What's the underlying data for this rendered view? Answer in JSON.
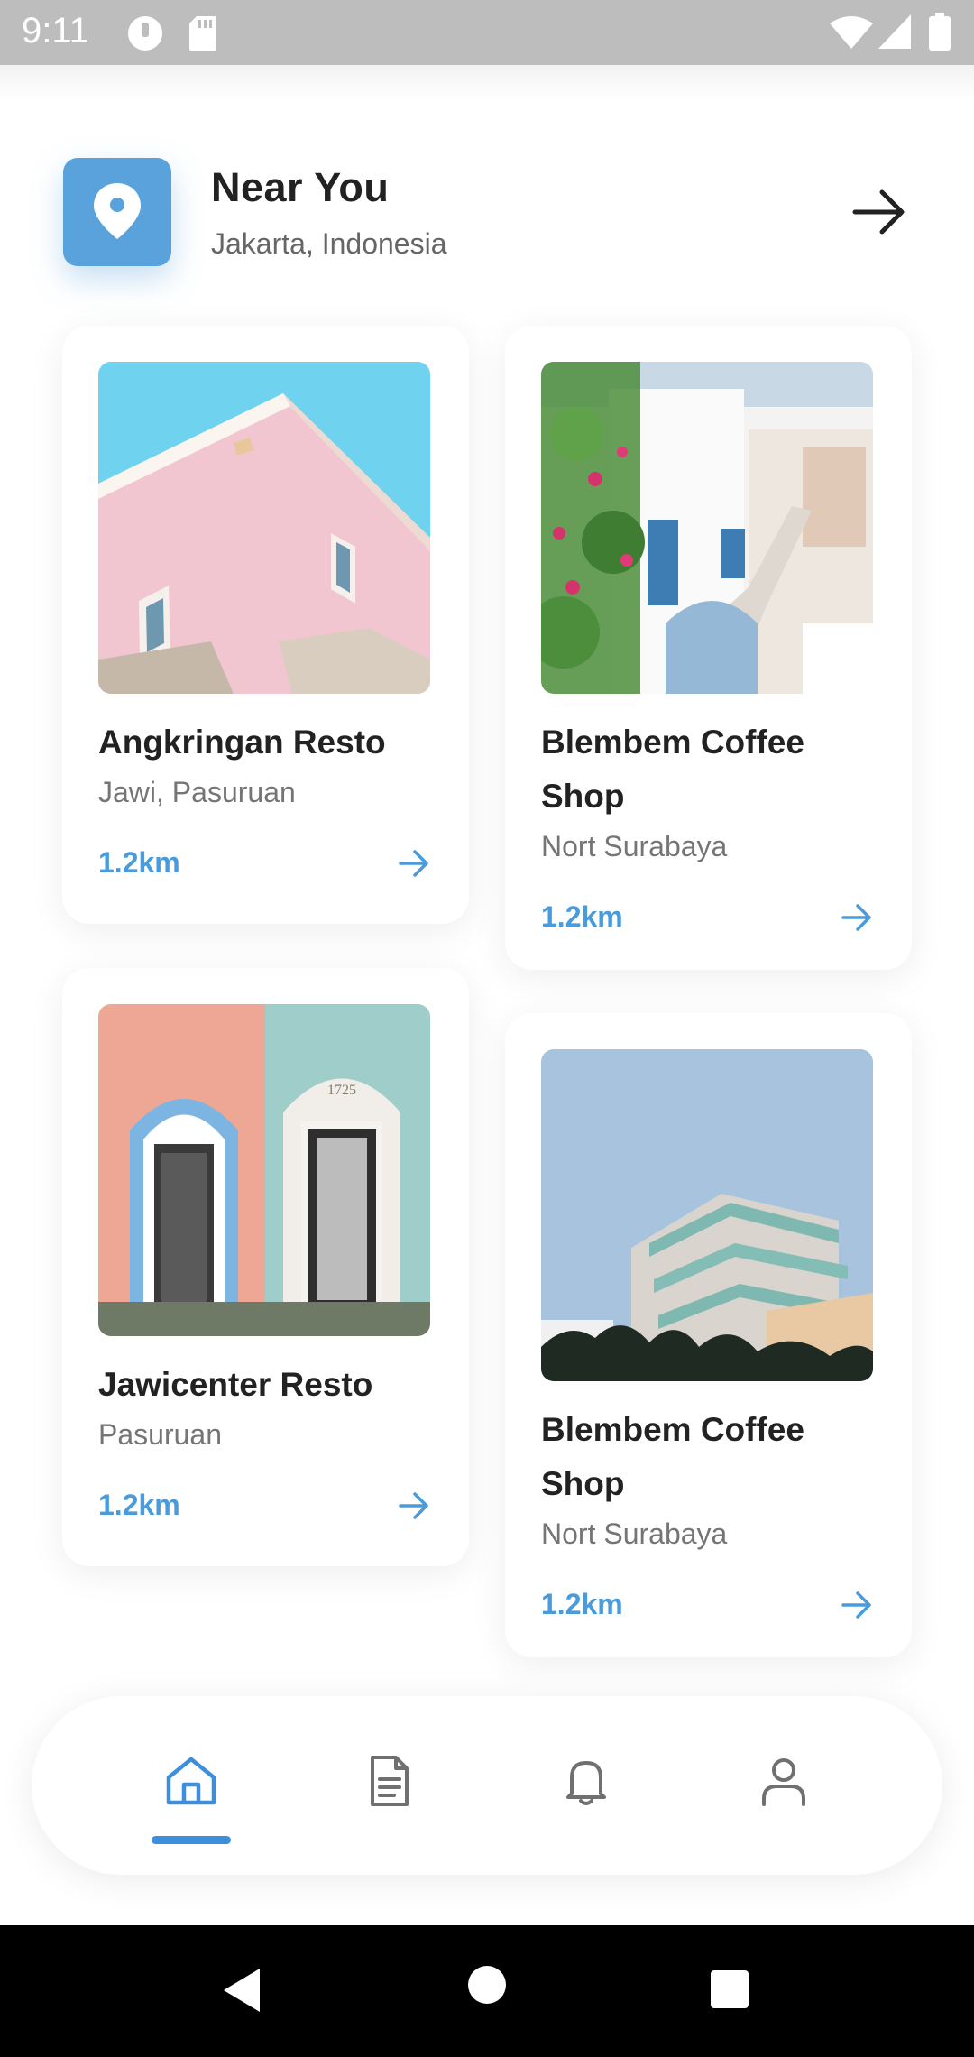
{
  "status_bar": {
    "time": "9:11",
    "icons": [
      "mask-icon",
      "sd-card-icon",
      "wifi-icon",
      "signal-icon",
      "battery-icon"
    ]
  },
  "header": {
    "icon": "location-pin-icon",
    "title": "Near You",
    "subtitle": "Jakarta, Indonesia",
    "action_icon": "arrow-right-icon"
  },
  "places": [
    {
      "name": "Angkringan Resto",
      "location": "Jawi, Pasuruan",
      "distance": "1.2km",
      "image": "pink-building-photo"
    },
    {
      "name": "Blembem Coffee Shop",
      "location": "Nort Surabaya",
      "distance": "1.2km",
      "image": "santorini-stairs-photo"
    },
    {
      "name": "Jawicenter Resto",
      "location": "Pasuruan",
      "distance": "1.2km",
      "image": "arched-doors-photo"
    },
    {
      "name": "Blembem Coffee Shop",
      "location": "Nort Surabaya",
      "distance": "1.2km",
      "image": "modern-hotel-photo"
    }
  ],
  "bottom_nav": {
    "active": "home",
    "items": [
      "home-icon",
      "document-icon",
      "bell-icon",
      "user-icon"
    ]
  },
  "colors": {
    "accent": "#4a9bdb",
    "pin_tile": "#5aa2dc",
    "title_text": "#222222",
    "muted_text": "#757575",
    "inactive_icon": "#707070"
  }
}
